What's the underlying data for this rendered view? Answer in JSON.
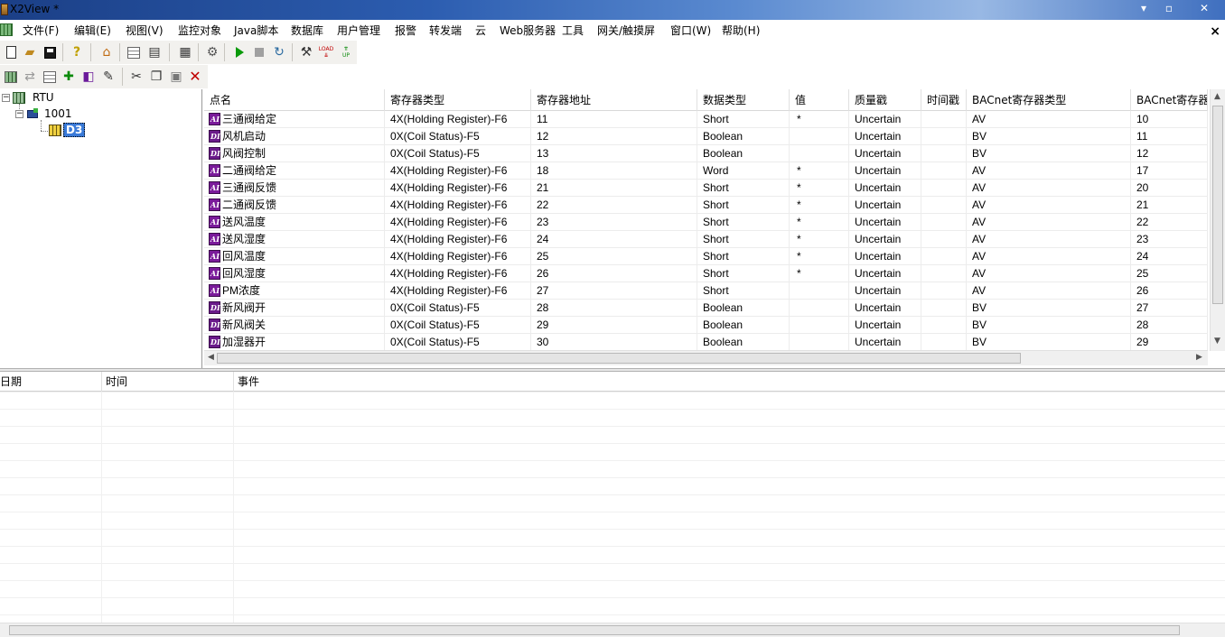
{
  "window": {
    "title": "X2View *",
    "minimize": "▾",
    "maximize": "▫",
    "close": "✕"
  },
  "menu": {
    "items": [
      "文件(F)",
      "编辑(E)",
      "视图(V)",
      "监控对象",
      "Java脚本",
      "数据库",
      "用户管理",
      "报警",
      "转发端",
      "云",
      "Web服务器",
      "工具",
      "网关/触摸屏",
      "窗口(W)",
      "帮助(H)"
    ],
    "mdi_close": "×"
  },
  "toolbar1": {
    "icons": [
      "new-document-icon",
      "open-folder-icon",
      "save-icon",
      "help-icon",
      "home-icon",
      "grid-view-icon",
      "monitor-icon",
      "network-icon",
      "run-config-icon",
      "play-icon",
      "stop-icon",
      "refresh-icon",
      "tools-icon",
      "load-icon",
      "upload-icon"
    ],
    "load_label": "LOAD",
    "upload_label": "UP"
  },
  "toolbar2": {
    "icons": [
      "add-table-icon",
      "link-icon",
      "grid-icon",
      "add-point-icon",
      "cube-icon",
      "edit-icon",
      "cut-icon",
      "copy-icon",
      "paste-icon",
      "delete-icon"
    ]
  },
  "tree": {
    "root": "RTU",
    "device": "1001",
    "node": "D3"
  },
  "grid": {
    "columns": [
      "点名",
      "寄存器类型",
      "寄存器地址",
      "数据类型",
      "值",
      "质量戳",
      "时间戳",
      "BACnet寄存器类型",
      "BACnet寄存器地"
    ],
    "rows": [
      {
        "icon": "AI",
        "name": "三通阀给定",
        "reg_type": "4X(Holding Register)-F6",
        "addr": "11",
        "dtype": "Short",
        "value": "*",
        "quality": "Uncertain",
        "ts": "",
        "bac_type": "AV",
        "bac_addr": "10"
      },
      {
        "icon": "DI",
        "name": "风机启动",
        "reg_type": "0X(Coil Status)-F5",
        "addr": "12",
        "dtype": "Boolean",
        "value": "",
        "quality": "Uncertain",
        "ts": "",
        "bac_type": "BV",
        "bac_addr": "11"
      },
      {
        "icon": "DI",
        "name": "风阀控制",
        "reg_type": "0X(Coil Status)-F5",
        "addr": "13",
        "dtype": "Boolean",
        "value": "",
        "quality": "Uncertain",
        "ts": "",
        "bac_type": "BV",
        "bac_addr": "12"
      },
      {
        "icon": "AI",
        "name": "二通阀给定",
        "reg_type": "4X(Holding Register)-F6",
        "addr": "18",
        "dtype": "Word",
        "value": "*",
        "quality": "Uncertain",
        "ts": "",
        "bac_type": "AV",
        "bac_addr": "17"
      },
      {
        "icon": "AI",
        "name": "三通阀反馈",
        "reg_type": "4X(Holding Register)-F6",
        "addr": "21",
        "dtype": "Short",
        "value": "*",
        "quality": "Uncertain",
        "ts": "",
        "bac_type": "AV",
        "bac_addr": "20"
      },
      {
        "icon": "AI",
        "name": "二通阀反馈",
        "reg_type": "4X(Holding Register)-F6",
        "addr": "22",
        "dtype": "Short",
        "value": "*",
        "quality": "Uncertain",
        "ts": "",
        "bac_type": "AV",
        "bac_addr": "21"
      },
      {
        "icon": "AI",
        "name": "送风温度",
        "reg_type": "4X(Holding Register)-F6",
        "addr": "23",
        "dtype": "Short",
        "value": "*",
        "quality": "Uncertain",
        "ts": "",
        "bac_type": "AV",
        "bac_addr": "22"
      },
      {
        "icon": "AI",
        "name": "送风湿度",
        "reg_type": "4X(Holding Register)-F6",
        "addr": "24",
        "dtype": "Short",
        "value": "*",
        "quality": "Uncertain",
        "ts": "",
        "bac_type": "AV",
        "bac_addr": "23"
      },
      {
        "icon": "AI",
        "name": "回风温度",
        "reg_type": "4X(Holding Register)-F6",
        "addr": "25",
        "dtype": "Short",
        "value": "*",
        "quality": "Uncertain",
        "ts": "",
        "bac_type": "AV",
        "bac_addr": "24"
      },
      {
        "icon": "AI",
        "name": "回风湿度",
        "reg_type": "4X(Holding Register)-F6",
        "addr": "26",
        "dtype": "Short",
        "value": "*",
        "quality": "Uncertain",
        "ts": "",
        "bac_type": "AV",
        "bac_addr": "25"
      },
      {
        "icon": "AI",
        "name": "PM浓度",
        "reg_type": "4X(Holding Register)-F6",
        "addr": "27",
        "dtype": "Short",
        "value": "",
        "quality": "Uncertain",
        "ts": "",
        "bac_type": "AV",
        "bac_addr": "26"
      },
      {
        "icon": "DI",
        "name": "新风阀开",
        "reg_type": "0X(Coil Status)-F5",
        "addr": "28",
        "dtype": "Boolean",
        "value": "",
        "quality": "Uncertain",
        "ts": "",
        "bac_type": "BV",
        "bac_addr": "27"
      },
      {
        "icon": "DI",
        "name": "新风阀关",
        "reg_type": "0X(Coil Status)-F5",
        "addr": "29",
        "dtype": "Boolean",
        "value": "",
        "quality": "Uncertain",
        "ts": "",
        "bac_type": "BV",
        "bac_addr": "28"
      },
      {
        "icon": "DI",
        "name": "加湿器开",
        "reg_type": "0X(Coil Status)-F5",
        "addr": "30",
        "dtype": "Boolean",
        "value": "",
        "quality": "Uncertain",
        "ts": "",
        "bac_type": "BV",
        "bac_addr": "29"
      }
    ]
  },
  "log": {
    "columns": [
      "日期",
      "时间",
      "事件"
    ]
  },
  "colors": {
    "point_icon": "#7a1a9a",
    "selected_node": "#3a7ad8",
    "titlebar": "#2c5db0"
  }
}
